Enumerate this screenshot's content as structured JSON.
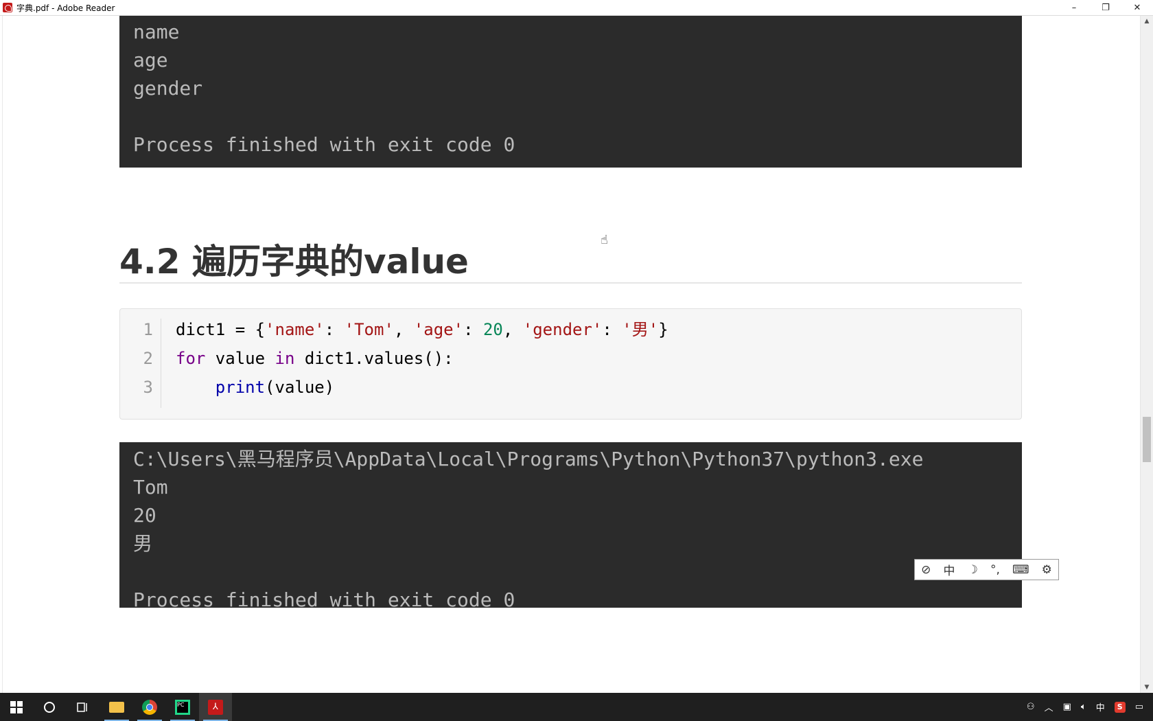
{
  "window": {
    "title": "字典.pdf - Adobe Reader",
    "controls": {
      "minimize": "–",
      "restore": "❐",
      "close": "✕"
    }
  },
  "document": {
    "top_terminal": {
      "lines": [
        "name",
        "age",
        "gender",
        "",
        "Process finished with exit code 0"
      ]
    },
    "heading": "4.2 遍历字典的value",
    "code_block": {
      "line_numbers": [
        "1",
        "2",
        "3"
      ],
      "lines": [
        [
          {
            "t": "dict1 = {",
            "c": ""
          },
          {
            "t": "'name'",
            "c": "str"
          },
          {
            "t": ": ",
            "c": ""
          },
          {
            "t": "'Tom'",
            "c": "str"
          },
          {
            "t": ", ",
            "c": ""
          },
          {
            "t": "'age'",
            "c": "str"
          },
          {
            "t": ": ",
            "c": ""
          },
          {
            "t": "20",
            "c": "num"
          },
          {
            "t": ", ",
            "c": ""
          },
          {
            "t": "'gender'",
            "c": "str"
          },
          {
            "t": ": ",
            "c": ""
          },
          {
            "t": "'男'",
            "c": "str"
          },
          {
            "t": "}",
            "c": ""
          }
        ],
        [
          {
            "t": "for",
            "c": "kw"
          },
          {
            "t": " value ",
            "c": ""
          },
          {
            "t": "in",
            "c": "kw"
          },
          {
            "t": " dict1.values():",
            "c": ""
          }
        ],
        [
          {
            "t": "    ",
            "c": ""
          },
          {
            "t": "print",
            "c": "fn"
          },
          {
            "t": "(value)",
            "c": ""
          }
        ]
      ]
    },
    "bottom_terminal": {
      "lines": [
        "C:\\Users\\黑马程序员\\AppData\\Local\\Programs\\Python\\Python37\\python3.exe",
        "Tom",
        "20",
        "男",
        "",
        "Process finished with exit code 0"
      ]
    }
  },
  "ime_toolbar": {
    "items": [
      {
        "name": "ime-logo-icon",
        "glyph": "⊘"
      },
      {
        "name": "ime-mode-chinese",
        "glyph": "中"
      },
      {
        "name": "ime-halfwidth-icon",
        "glyph": "☽"
      },
      {
        "name": "ime-punctuation-icon",
        "glyph": "°,"
      },
      {
        "name": "ime-keyboard-icon",
        "glyph": "⌨"
      },
      {
        "name": "ime-settings-icon",
        "glyph": "⚙"
      }
    ]
  },
  "taskbar": {
    "tray": {
      "ime_indicator": "中",
      "sogou": "S"
    }
  },
  "colors": {
    "terminal_bg": "#2b2b2b",
    "terminal_fg": "#bbbbbb",
    "string": "#a31515",
    "number": "#098658",
    "keyword": "#770088",
    "builtin": "#0000aa"
  }
}
